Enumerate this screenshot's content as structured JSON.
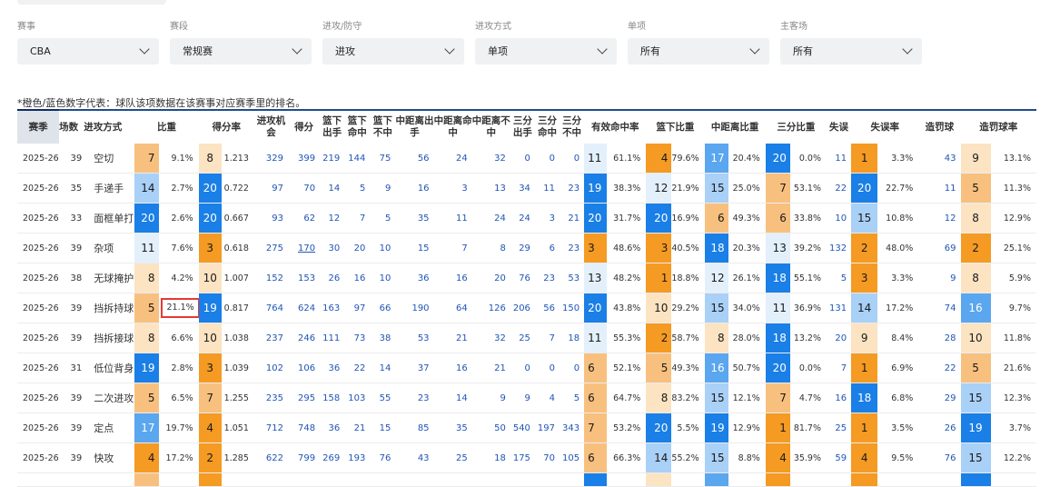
{
  "filters": [
    {
      "label": "赛事",
      "value": "CBA"
    },
    {
      "label": "赛段",
      "value": "常规赛"
    },
    {
      "label": "进攻/防守",
      "value": "进攻"
    },
    {
      "label": "进攻方式",
      "value": "单项"
    },
    {
      "label": "单项",
      "value": "所有"
    },
    {
      "label": "主客场",
      "value": "所有"
    }
  ],
  "note": "*橙色/蓝色数字代表：球队该项数据在该赛事对应赛季里的排名。",
  "headers": [
    "赛季",
    "场数",
    "进攻方式",
    "比重",
    "得分率",
    "进攻机会",
    "得分",
    "篮下出手",
    "篮下命中",
    "篮下不中",
    "中距离出手",
    "中距离命中",
    "中距离不中",
    "三分出手",
    "三分命中",
    "三分不中",
    "有效命中率",
    "篮下比重",
    "中距离比重",
    "三分比重",
    "失误",
    "失误率",
    "造罚球",
    "造罚球率"
  ],
  "colors": {
    "orange_dark": "#f59a23",
    "orange_mid": "#f8c07e",
    "orange_light": "#fce3c2",
    "blue_dark": "#1a7fe6",
    "blue_mid": "#5aa6ef",
    "blue_light": "#a9d0f7",
    "blue_faint": "#e3f0fc",
    "highlight_border": "#e53935"
  },
  "rows": [
    {
      "season": "2025-26",
      "games": "39",
      "type": "空切",
      "ratio_rank": "7",
      "ratio": "9.1%",
      "score_rank": "8",
      "score_rate": "1.213",
      "chances": "329",
      "points": "399",
      "rim_att": "219",
      "rim_made": "144",
      "rim_miss": "75",
      "mid_att": "56",
      "mid_made": "24",
      "mid_miss": "32",
      "three_att": "0",
      "three_made": "0",
      "three_miss": "0",
      "efg_rank": "11",
      "efg": "61.1%",
      "rim_share_rank": "4",
      "rim_share": "79.6%",
      "mid_share_rank": "17",
      "mid_share": "20.4%",
      "three_share_rank": "20",
      "three_share": "0.0%",
      "turnovers": "11",
      "tov_rank": "1",
      "tov_rate": "3.3%",
      "fouls": "43",
      "foul_rank": "9",
      "foul_rate": "13.1%"
    },
    {
      "season": "2025-26",
      "games": "35",
      "type": "手递手",
      "ratio_rank": "14",
      "ratio": "2.7%",
      "score_rank": "20",
      "score_rate": "0.722",
      "chances": "97",
      "points": "70",
      "rim_att": "14",
      "rim_made": "5",
      "rim_miss": "9",
      "mid_att": "16",
      "mid_made": "3",
      "mid_miss": "13",
      "three_att": "34",
      "three_made": "11",
      "three_miss": "23",
      "efg_rank": "19",
      "efg": "38.3%",
      "rim_share_rank": "12",
      "rim_share": "21.9%",
      "mid_share_rank": "15",
      "mid_share": "25.0%",
      "three_share_rank": "7",
      "three_share": "53.1%",
      "turnovers": "22",
      "tov_rank": "20",
      "tov_rate": "22.7%",
      "fouls": "11",
      "foul_rank": "5",
      "foul_rate": "11.3%"
    },
    {
      "season": "2025-26",
      "games": "33",
      "type": "面框单打",
      "ratio_rank": "20",
      "ratio": "2.6%",
      "score_rank": "20",
      "score_rate": "0.667",
      "chances": "93",
      "points": "62",
      "rim_att": "12",
      "rim_made": "7",
      "rim_miss": "5",
      "mid_att": "35",
      "mid_made": "11",
      "mid_miss": "24",
      "three_att": "24",
      "three_made": "3",
      "three_miss": "21",
      "efg_rank": "20",
      "efg": "31.7%",
      "rim_share_rank": "20",
      "rim_share": "16.9%",
      "mid_share_rank": "6",
      "mid_share": "49.3%",
      "three_share_rank": "6",
      "three_share": "33.8%",
      "turnovers": "10",
      "tov_rank": "15",
      "tov_rate": "10.8%",
      "fouls": "12",
      "foul_rank": "8",
      "foul_rate": "12.9%"
    },
    {
      "season": "2025-26",
      "games": "39",
      "type": "杂项",
      "ratio_rank": "11",
      "ratio": "7.6%",
      "score_rank": "3",
      "score_rate": "0.618",
      "chances": "275",
      "points": "170",
      "rim_att": "30",
      "rim_made": "20",
      "rim_miss": "10",
      "mid_att": "15",
      "mid_made": "7",
      "mid_miss": "8",
      "three_att": "29",
      "three_made": "6",
      "three_miss": "23",
      "efg_rank": "3",
      "efg": "48.6%",
      "rim_share_rank": "3",
      "rim_share": "40.5%",
      "mid_share_rank": "18",
      "mid_share": "20.3%",
      "three_share_rank": "13",
      "three_share": "39.2%",
      "turnovers": "132",
      "tov_rank": "2",
      "tov_rate": "48.0%",
      "fouls": "69",
      "foul_rank": "2",
      "foul_rate": "25.1%"
    },
    {
      "season": "2025-26",
      "games": "38",
      "type": "无球掩护",
      "ratio_rank": "8",
      "ratio": "4.2%",
      "score_rank": "10",
      "score_rate": "1.007",
      "chances": "152",
      "points": "153",
      "rim_att": "26",
      "rim_made": "16",
      "rim_miss": "10",
      "mid_att": "36",
      "mid_made": "16",
      "mid_miss": "20",
      "three_att": "76",
      "three_made": "23",
      "three_miss": "53",
      "efg_rank": "13",
      "efg": "48.2%",
      "rim_share_rank": "1",
      "rim_share": "18.8%",
      "mid_share_rank": "12",
      "mid_share": "26.1%",
      "three_share_rank": "18",
      "three_share": "55.1%",
      "turnovers": "5",
      "tov_rank": "3",
      "tov_rate": "3.3%",
      "fouls": "9",
      "foul_rank": "8",
      "foul_rate": "5.9%"
    },
    {
      "season": "2025-26",
      "games": "39",
      "type": "挡拆持球",
      "ratio_rank": "5",
      "ratio": "21.1%",
      "score_rank": "19",
      "score_rate": "0.817",
      "chances": "764",
      "points": "624",
      "rim_att": "163",
      "rim_made": "97",
      "rim_miss": "66",
      "mid_att": "190",
      "mid_made": "64",
      "mid_miss": "126",
      "three_att": "206",
      "three_made": "56",
      "three_miss": "150",
      "efg_rank": "20",
      "efg": "43.8%",
      "rim_share_rank": "10",
      "rim_share": "29.2%",
      "mid_share_rank": "15",
      "mid_share": "34.0%",
      "three_share_rank": "11",
      "three_share": "36.9%",
      "turnovers": "131",
      "tov_rank": "14",
      "tov_rate": "17.2%",
      "fouls": "74",
      "foul_rank": "16",
      "foul_rate": "9.7%"
    },
    {
      "season": "2025-26",
      "games": "39",
      "type": "挡拆接球",
      "ratio_rank": "8",
      "ratio": "6.6%",
      "score_rank": "10",
      "score_rate": "1.038",
      "chances": "237",
      "points": "246",
      "rim_att": "111",
      "rim_made": "73",
      "rim_miss": "38",
      "mid_att": "53",
      "mid_made": "21",
      "mid_miss": "32",
      "three_att": "25",
      "three_made": "7",
      "three_miss": "18",
      "efg_rank": "11",
      "efg": "55.3%",
      "rim_share_rank": "2",
      "rim_share": "58.7%",
      "mid_share_rank": "8",
      "mid_share": "28.0%",
      "three_share_rank": "18",
      "three_share": "13.2%",
      "turnovers": "20",
      "tov_rank": "9",
      "tov_rate": "8.4%",
      "fouls": "28",
      "foul_rank": "10",
      "foul_rate": "11.8%"
    },
    {
      "season": "2025-26",
      "games": "31",
      "type": "低位背身",
      "ratio_rank": "19",
      "ratio": "2.8%",
      "score_rank": "3",
      "score_rate": "1.039",
      "chances": "102",
      "points": "106",
      "rim_att": "36",
      "rim_made": "22",
      "rim_miss": "14",
      "mid_att": "37",
      "mid_made": "16",
      "mid_miss": "21",
      "three_att": "0",
      "three_made": "0",
      "three_miss": "0",
      "efg_rank": "6",
      "efg": "52.1%",
      "rim_share_rank": "5",
      "rim_share": "49.3%",
      "mid_share_rank": "16",
      "mid_share": "50.7%",
      "three_share_rank": "20",
      "three_share": "0.0%",
      "turnovers": "7",
      "tov_rank": "1",
      "tov_rate": "6.9%",
      "fouls": "22",
      "foul_rank": "5",
      "foul_rate": "21.6%"
    },
    {
      "season": "2025-26",
      "games": "39",
      "type": "二次进攻",
      "ratio_rank": "5",
      "ratio": "6.5%",
      "score_rank": "7",
      "score_rate": "1.255",
      "chances": "235",
      "points": "295",
      "rim_att": "158",
      "rim_made": "103",
      "rim_miss": "55",
      "mid_att": "23",
      "mid_made": "14",
      "mid_miss": "9",
      "three_att": "9",
      "three_made": "4",
      "three_miss": "5",
      "efg_rank": "6",
      "efg": "64.7%",
      "rim_share_rank": "8",
      "rim_share": "83.2%",
      "mid_share_rank": "15",
      "mid_share": "12.1%",
      "three_share_rank": "7",
      "three_share": "4.7%",
      "turnovers": "16",
      "tov_rank": "18",
      "tov_rate": "6.8%",
      "fouls": "29",
      "foul_rank": "15",
      "foul_rate": "12.3%"
    },
    {
      "season": "2025-26",
      "games": "39",
      "type": "定点",
      "ratio_rank": "17",
      "ratio": "19.7%",
      "score_rank": "4",
      "score_rate": "1.051",
      "chances": "712",
      "points": "748",
      "rim_att": "36",
      "rim_made": "21",
      "rim_miss": "15",
      "mid_att": "85",
      "mid_made": "35",
      "mid_miss": "50",
      "three_att": "540",
      "three_made": "197",
      "three_miss": "343",
      "efg_rank": "7",
      "efg": "53.2%",
      "rim_share_rank": "20",
      "rim_share": "5.5%",
      "mid_share_rank": "19",
      "mid_share": "12.9%",
      "three_share_rank": "1",
      "three_share": "81.7%",
      "turnovers": "25",
      "tov_rank": "1",
      "tov_rate": "3.5%",
      "fouls": "26",
      "foul_rank": "19",
      "foul_rate": "3.7%"
    },
    {
      "season": "2025-26",
      "games": "39",
      "type": "快攻",
      "ratio_rank": "4",
      "ratio": "17.2%",
      "score_rank": "2",
      "score_rate": "1.285",
      "chances": "622",
      "points": "799",
      "rim_att": "269",
      "rim_made": "193",
      "rim_miss": "76",
      "mid_att": "43",
      "mid_made": "25",
      "mid_miss": "18",
      "three_att": "175",
      "three_made": "70",
      "three_miss": "105",
      "efg_rank": "6",
      "efg": "66.3%",
      "rim_share_rank": "14",
      "rim_share": "55.2%",
      "mid_share_rank": "15",
      "mid_share": "8.8%",
      "three_share_rank": "4",
      "three_share": "35.9%",
      "turnovers": "59",
      "tov_rank": "4",
      "tov_rate": "9.5%",
      "fouls": "76",
      "foul_rank": "15",
      "foul_rate": "12.2%"
    }
  ]
}
